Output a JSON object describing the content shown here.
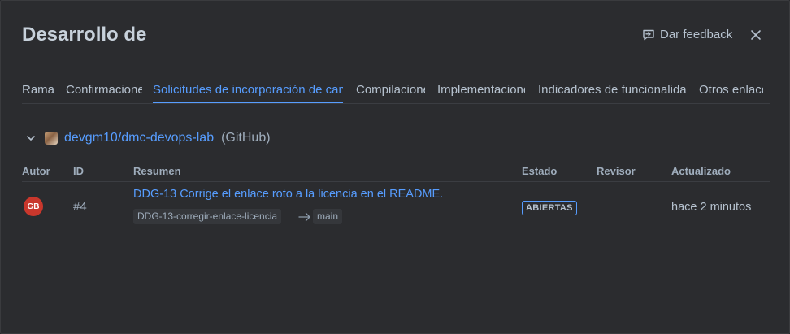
{
  "dialog": {
    "title": "Desarrollo de",
    "feedback_label": "Dar feedback"
  },
  "tabs": [
    {
      "label": "Rama"
    },
    {
      "label": "Confirmaciones"
    },
    {
      "label": "Solicitudes de incorporación de cambios",
      "active": true
    },
    {
      "label": "Compilaciones"
    },
    {
      "label": "Implementaciones"
    },
    {
      "label": "Indicadores de funcionalidad"
    },
    {
      "label": "Otros enlaces"
    }
  ],
  "repo": {
    "name": "devgm10/dmc-devops-lab",
    "provider": "(GitHub)"
  },
  "table": {
    "headers": {
      "author": "Autor",
      "id": "ID",
      "summary": "Resumen",
      "status": "Estado",
      "reviewer": "Revisor",
      "updated": "Actualizado"
    },
    "rows": [
      {
        "author_initials": "GB",
        "id": "#4",
        "title": "DDG-13 Corrige el enlace roto a la licencia en el README.",
        "source_branch": "DDG-13-corregir-enlace-licencia",
        "target_branch": "main",
        "status": "ABIERTAS",
        "reviewer": "",
        "updated": "hace 2 minutos"
      }
    ]
  },
  "colors": {
    "accent": "#579dff",
    "avatar": "#c9372c",
    "background": "#2b2c2f"
  },
  "icons": [
    "feedback-icon",
    "close-icon",
    "chevron-down-icon",
    "arrow-right-icon"
  ]
}
